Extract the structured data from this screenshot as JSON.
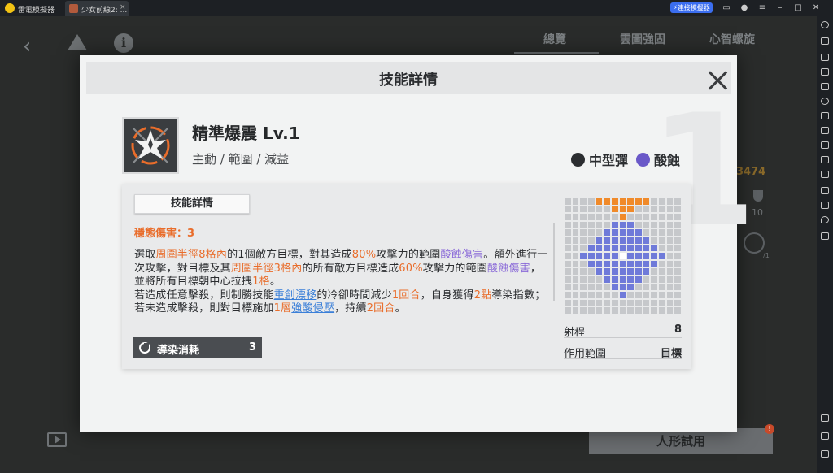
{
  "emulator": {
    "app_name": "雷電模擬器",
    "tab_title": "少女前線2: ...",
    "tab_close": "×",
    "sync_label": "⚡連接模擬器",
    "topbar_icons": [
      "menu-icon",
      "user-icon",
      "bars-icon",
      "minimize-icon",
      "maximize-icon",
      "close-icon"
    ]
  },
  "game": {
    "tabs": [
      "總覽",
      "雲圖強固",
      "心智螺旋"
    ],
    "resource_value": "3474",
    "stat_value": "10",
    "stat_sub": "/1",
    "trial_button": "人形試用",
    "trial_badge": "!"
  },
  "modal": {
    "title": "技能詳情",
    "skill_name": "精準爆震 Lv.1",
    "skill_tags": "主動 / 範圍 / 減益",
    "attributes": [
      {
        "label": "中型彈",
        "icon": "medium-ammo-icon",
        "color": "#2b2d30"
      },
      {
        "label": "酸蝕",
        "icon": "acid-icon",
        "color": "#6a58c8"
      }
    ],
    "big_number": "1",
    "panel_tab": "技能詳情",
    "stability_damage": "穩態傷害：3",
    "cost_label": "導染消耗",
    "cost_value": "3",
    "range_label": "射程",
    "range_value": "8",
    "area_label": "作用範圍",
    "area_value": "目標",
    "grid_pattern": [
      "....ooooooo....",
      "......ooo......",
      ".......o.......",
      "......hhh......",
      ".....hhhhh.....",
      "....hhhhhhh....",
      "...hhhhhhhhh...",
      "..hhhhhchhhhh..",
      "...hhhhhhhhh...",
      "....hhhhhhh....",
      ".....hhhhh.....",
      "......hhh......",
      ".......h.......",
      "...............",
      "..............."
    ],
    "description": [
      {
        "t": "選取",
        "s": "n"
      },
      {
        "t": "周圍半徑8格內",
        "s": "o"
      },
      {
        "t": "的1個敵方目標，對其造成",
        "s": "n"
      },
      {
        "t": "80%",
        "s": "o"
      },
      {
        "t": "攻擊力的範圍",
        "s": "n"
      },
      {
        "t": "酸蝕傷害",
        "s": "p"
      },
      {
        "t": "。額外進行一次攻擊，對目標及其",
        "s": "n"
      },
      {
        "t": "周圍半徑3格內",
        "s": "o"
      },
      {
        "t": "的所有敵方目標造成",
        "s": "n"
      },
      {
        "t": "60%",
        "s": "o"
      },
      {
        "t": "攻擊力的範圍",
        "s": "n"
      },
      {
        "t": "酸蝕傷害",
        "s": "p"
      },
      {
        "t": "，並將所有目標朝中心拉拽",
        "s": "n"
      },
      {
        "t": "1格",
        "s": "o"
      },
      {
        "t": "。",
        "s": "n"
      },
      {
        "t": "\n",
        "s": "br"
      },
      {
        "t": "若造成任意擊殺，則制勝技能",
        "s": "n"
      },
      {
        "t": "重創漂移",
        "s": "b"
      },
      {
        "t": "的冷卻時間減少",
        "s": "n"
      },
      {
        "t": "1回合",
        "s": "o"
      },
      {
        "t": "，自身獲得",
        "s": "n"
      },
      {
        "t": "2點",
        "s": "o"
      },
      {
        "t": "導染指數；若未造成擊殺，則對目標施加",
        "s": "n"
      },
      {
        "t": "1層",
        "s": "o"
      },
      {
        "t": "強酸侵壓",
        "s": "b"
      },
      {
        "t": "，持續",
        "s": "n"
      },
      {
        "t": "2回合",
        "s": "o"
      },
      {
        "t": "。",
        "s": "n"
      }
    ]
  }
}
